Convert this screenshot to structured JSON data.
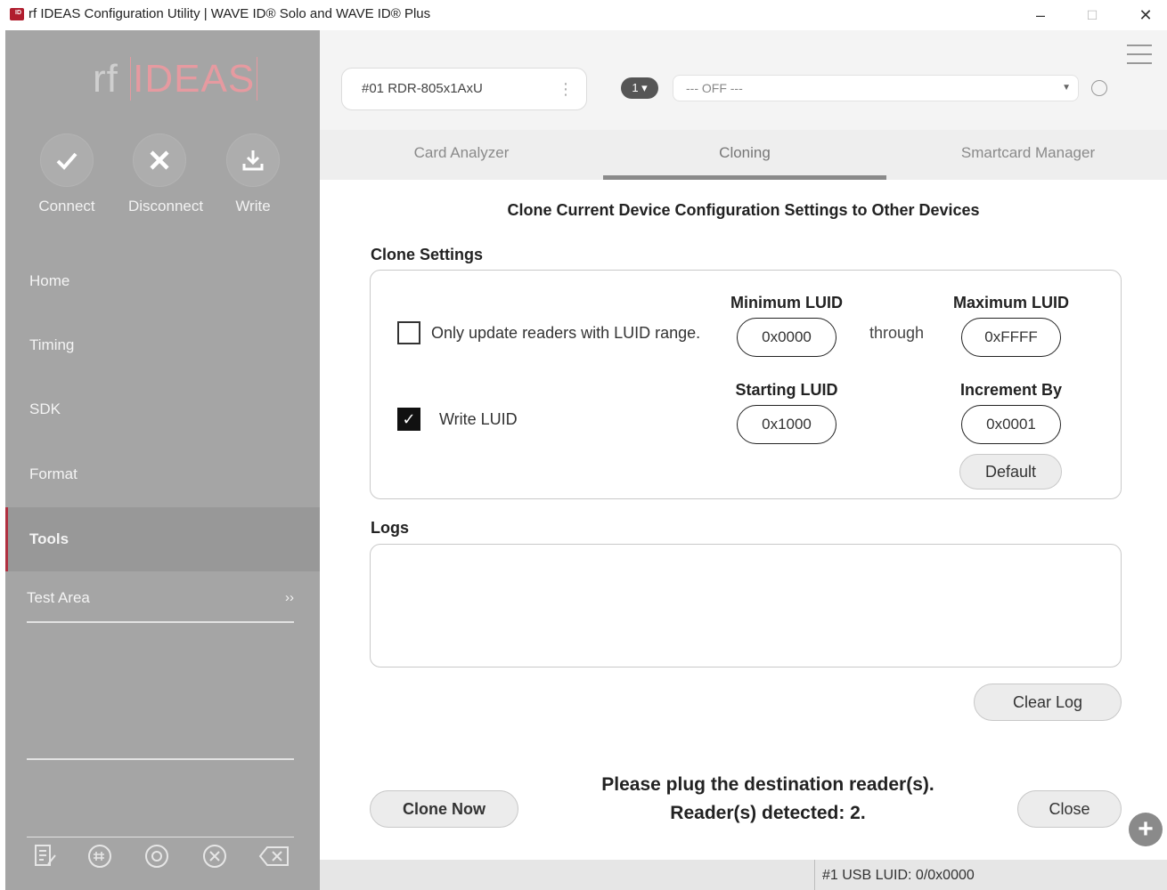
{
  "window": {
    "title": "rf IDEAS Configuration Utility | WAVE ID® Solo and WAVE ID® Plus",
    "controls": [
      "–",
      "☐",
      "✕"
    ]
  },
  "sidebar": {
    "logo_rf": "rf",
    "logo_ideas": "IDEAS",
    "quick_actions": [
      {
        "label": "Connect",
        "icon": "check-icon"
      },
      {
        "label": "Disconnect",
        "icon": "x-icon"
      },
      {
        "label": "Write",
        "icon": "download-icon"
      }
    ],
    "nav": [
      "Home",
      "Timing",
      "SDK",
      "Format",
      "Tools"
    ],
    "active_nav": "Tools",
    "test_area": "Test Area",
    "test_area_chevron": "››",
    "bottom_icons": [
      "notes-icon",
      "hash-icon",
      "rotate-icon",
      "cancel-icon",
      "backspace-icon"
    ]
  },
  "topbar": {
    "device": "#01 RDR-805x1AxU",
    "reader_count": "1",
    "mode_select": "--- OFF ---"
  },
  "tabs": [
    "Card Analyzer",
    "Cloning",
    "Smartcard Manager"
  ],
  "active_tab": "Cloning",
  "content": {
    "heading": "Clone Current Device Configuration Settings to Other Devices",
    "clone_settings_label": "Clone Settings",
    "only_update_label": "Only update readers with LUID range.",
    "only_update_checked": false,
    "write_luid_label": "Write LUID",
    "write_luid_checked": true,
    "min_luid_label": "Minimum LUID",
    "min_luid_value": "0x0000",
    "through": "through",
    "max_luid_label": "Maximum LUID",
    "max_luid_value": "0xFFFF",
    "starting_luid_label": "Starting LUID",
    "starting_luid_value": "0x1000",
    "increment_label": "Increment By",
    "increment_value": "0x0001",
    "default_button": "Default",
    "logs_label": "Logs",
    "logs_text": "",
    "clear_log_button": "Clear Log",
    "clone_now_button": "Clone Now",
    "status_line1": "Please plug the destination reader(s).",
    "status_line2": "Reader(s) detected: 2.",
    "close_button": "Close"
  },
  "statusbar": {
    "text": "#1 USB LUID: 0/0x0000"
  },
  "colors": {
    "sidebar_bg": "#a5a5a5",
    "sidebar_active": "#989898",
    "brand_red": "#b03040"
  }
}
